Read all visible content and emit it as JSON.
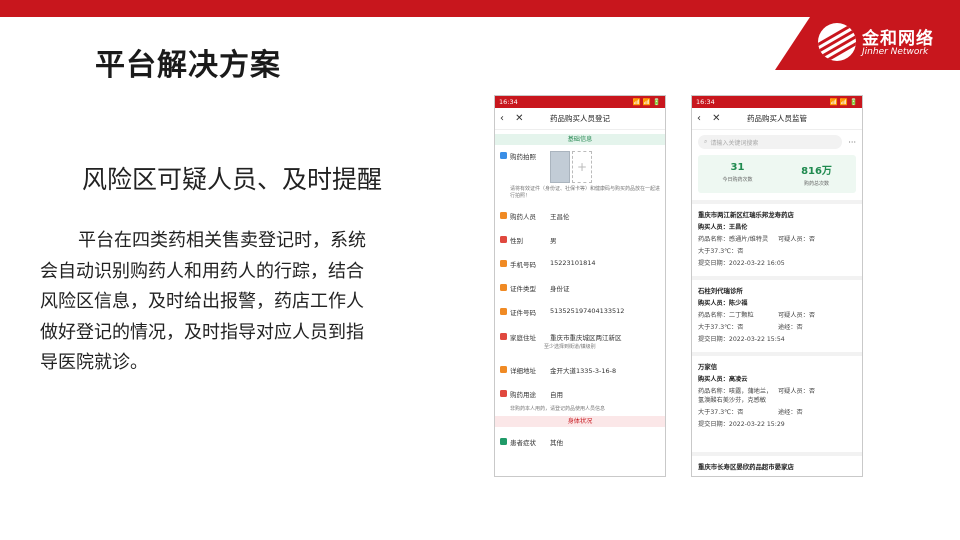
{
  "header": {
    "logo_cn": "金和网络",
    "logo_en": "Jinher Network",
    "title": "平台解决方案"
  },
  "slide": {
    "subtitle": "风险区可疑人员、及时提醒",
    "body": "平台在四类药相关售卖登记时，系统会自动识别购药人和用药人的行踪，结合风险区信息，及时给出报警，药店工作人做好登记的情况，及时指导对应人员到指导医院就诊。"
  },
  "phone1": {
    "status_time": "16:34",
    "status_right": "📶 📶 🔋",
    "nav_icons": "‹ ✕",
    "title": "药品购买人员登记",
    "section_basic": "基础信息",
    "photo_label": "购药拍照",
    "photo_add": "+",
    "photo_hint": "请将有效证件（身份证、社保卡等）和健康码与购买药品放在一起进行拍照！",
    "fields": [
      {
        "label": "购药人员",
        "value": "王昌伦",
        "color": "#f08a24"
      },
      {
        "label": "性别",
        "value": "男",
        "color": "#e0483e"
      },
      {
        "label": "手机号码",
        "value": "15223101814",
        "color": "#f08a24"
      },
      {
        "label": "证件类型",
        "value": "身份证",
        "color": "#f08a24"
      },
      {
        "label": "证件号码",
        "value": "513525197404133512",
        "color": "#f08a24"
      }
    ],
    "address_label": "家庭住址",
    "address_value": "重庆市重庆城区两江新区",
    "address_hint": "至少选择到街道/镇级别",
    "detail_label": "详细地址",
    "detail_value": "金开大道1335-3-16-8",
    "use_label": "购药用途",
    "use_value": "自用",
    "use_hint": "非购药本人用药，请登记药品使用人员信息",
    "section_body": "身体状况",
    "symptom_label": "患者症状",
    "symptom_value": "其他"
  },
  "phone2": {
    "status_time": "16:34",
    "status_right": "📶 📶 🔋",
    "nav_icons": "‹ ✕",
    "title": "药品购买人员监管",
    "search_placeholder": "请输入关键词搜索",
    "more_icon": "···",
    "stats": [
      {
        "value": "31",
        "label": "今日购药次数"
      },
      {
        "value": "816万",
        "label": "购药总次数"
      }
    ],
    "records": [
      {
        "store": "重庆市两江新区红瑞乐邦龙寿药店",
        "buyer": "购买人员：王昌伦",
        "drug": "药品名称：感通片/维特灵",
        "suspect": "可疑人员：否",
        "temp": "大于37.3℃：否",
        "trace": "",
        "date": "提交日期：2022-03-22 16:05"
      },
      {
        "store": "石柱刘代瑞诊所",
        "buyer": "购买人员：陈少福",
        "drug": "药品名称：二丁颗粒",
        "suspect": "可疑人员：否",
        "temp": "大于37.3℃：否",
        "trace": "途经：否",
        "date": "提交日期：2022-03-22 15:54"
      },
      {
        "store": "万家信",
        "buyer": "购买人员：高凌云",
        "drug": "药品名称：咳露，蒲地兰，氢溴酸右美沙芬，克感敏",
        "suspect": "可疑人员：否",
        "temp": "大于37.3℃：否",
        "trace": "途经：否",
        "date": "提交日期：2022-03-22 15:29"
      },
      {
        "store": "重庆市长寿区晏欣药品超市晏家店"
      }
    ]
  },
  "colors": {
    "brand_red": "#c8161d",
    "accent_green": "#1f8a4f"
  }
}
